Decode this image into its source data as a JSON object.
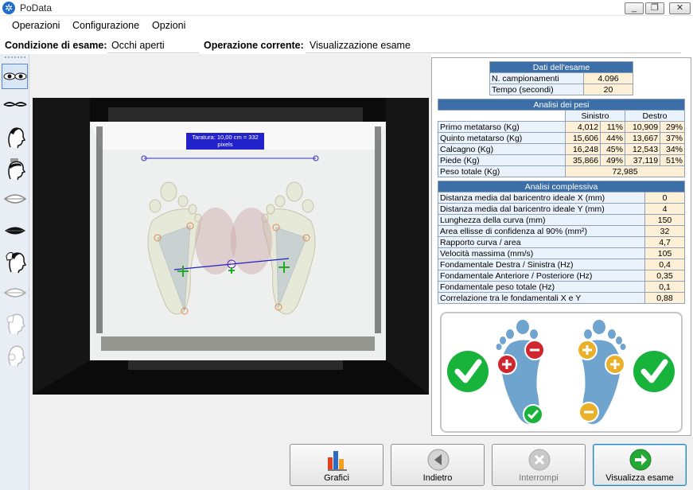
{
  "window": {
    "title": "PoData"
  },
  "menu": [
    "Operazioni",
    "Configurazione",
    "Opzioni"
  ],
  "condition": {
    "exam_label": "Condizione di esame:",
    "exam_value": "Occhi aperti",
    "op_label": "Operazione corrente:",
    "op_value": "Visualizzazione esame"
  },
  "left_toolbar": [
    "eyes-open-icon",
    "eyes-closed-icon",
    "head-icon",
    "head-bandage-icon",
    "lips-open-icon",
    "lips-closed-icon",
    "head-hand-icon",
    "lips-outline-icon",
    "head-faded-icon",
    "head-faded-2-icon"
  ],
  "image": {
    "taratura": "Taratura: 10,00 cm = 332 pixels"
  },
  "exam_data": {
    "title": "Dati dell'esame",
    "rows": [
      {
        "label": "N. campionamenti",
        "value": "4.096"
      },
      {
        "label": "Tempo (secondi)",
        "value": "20"
      }
    ]
  },
  "weights": {
    "title": "Analisi dei pesi",
    "col_left": "Sinistro",
    "col_right": "Destro",
    "rows": [
      {
        "label": "Primo metatarso (Kg)",
        "l": "4,012",
        "lp": "11%",
        "r": "10,909",
        "rp": "29%"
      },
      {
        "label": "Quinto metatarso (Kg)",
        "l": "15,606",
        "lp": "44%",
        "r": "13,667",
        "rp": "37%"
      },
      {
        "label": "Calcagno (Kg)",
        "l": "16,248",
        "lp": "45%",
        "r": "12,543",
        "rp": "34%"
      },
      {
        "label": "Piede (Kg)",
        "l": "35,866",
        "lp": "49%",
        "r": "37,119",
        "rp": "51%"
      }
    ],
    "total_label": "Peso totale (Kg)",
    "total_value": "72,985"
  },
  "overall": {
    "title": "Analisi complessiva",
    "rows": [
      {
        "label": "Distanza media dal baricentro ideale X (mm)",
        "value": "0"
      },
      {
        "label": "Distanza media dal baricentro ideale Y (mm)",
        "value": "4"
      },
      {
        "label": "Lunghezza della curva (mm)",
        "value": "150"
      },
      {
        "label": "Area ellisse di confidenza al 90% (mm²)",
        "value": "32"
      },
      {
        "label": "Rapporto curva / area",
        "value": "4,7"
      },
      {
        "label": "Velocità massima (mm/s)",
        "value": "105"
      },
      {
        "label": "Fondamentale Destra / Sinistra (Hz)",
        "value": "0,4"
      },
      {
        "label": "Fondamentale Anteriore / Posteriore (Hz)",
        "value": "0,35"
      },
      {
        "label": "Fondamentale peso totale (Hz)",
        "value": "0,1"
      },
      {
        "label": "Correlazione tra le fondamentali X e Y",
        "value": "0,88"
      }
    ]
  },
  "buttons": {
    "grafici": "Grafici",
    "indietro": "Indietro",
    "interrompi": "Interrompi",
    "visualizza": "Visualizza esame"
  },
  "colors": {
    "accent_blue": "#3c6fa8",
    "foot_blue": "#6fa4cf",
    "check_green": "#17b33a",
    "minus_red": "#d0262d",
    "plus_yellow": "#e9b12a"
  }
}
